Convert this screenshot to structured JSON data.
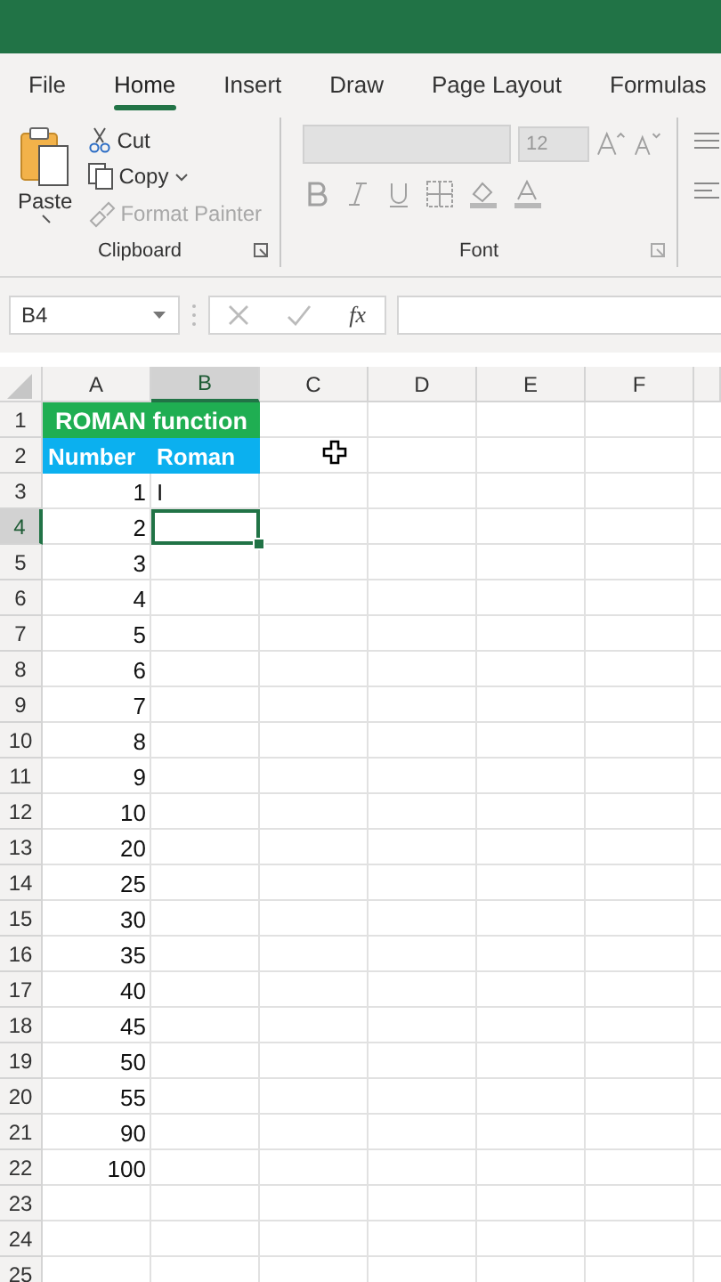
{
  "ribbon": {
    "tabs": [
      {
        "label": "File",
        "selected": false
      },
      {
        "label": "Home",
        "selected": true
      },
      {
        "label": "Insert",
        "selected": false
      },
      {
        "label": "Draw",
        "selected": false
      },
      {
        "label": "Page Layout",
        "selected": false
      },
      {
        "label": "Formulas",
        "selected": false
      }
    ],
    "clipboard": {
      "label": "Clipboard",
      "paste": "Paste",
      "cut": "Cut",
      "copy": "Copy",
      "format_painter": {
        "label": "Format Painter",
        "disabled": true
      }
    },
    "font": {
      "label": "Font",
      "size": "12",
      "disabled": true
    }
  },
  "formula_bar": {
    "name_box": "B4",
    "function_label": "fx"
  },
  "grid": {
    "columns": [
      {
        "label": "A",
        "selected": false
      },
      {
        "label": "B",
        "selected": true
      },
      {
        "label": "C",
        "selected": false
      },
      {
        "label": "D",
        "selected": false
      },
      {
        "label": "E",
        "selected": false
      },
      {
        "label": "F",
        "selected": false
      }
    ],
    "rows": [
      {
        "number": "1",
        "kind": "title",
        "a": "ROMAN function",
        "selected": false
      },
      {
        "number": "2",
        "kind": "header",
        "a": "Number",
        "b": "Roman",
        "selected": false
      },
      {
        "number": "3",
        "kind": "data",
        "a": "1",
        "b": "I",
        "selected": false
      },
      {
        "number": "4",
        "kind": "data",
        "a": "2",
        "selected": true
      },
      {
        "number": "5",
        "kind": "data",
        "a": "3",
        "selected": false
      },
      {
        "number": "6",
        "kind": "data",
        "a": "4",
        "selected": false
      },
      {
        "number": "7",
        "kind": "data",
        "a": "5",
        "selected": false
      },
      {
        "number": "8",
        "kind": "data",
        "a": "6",
        "selected": false
      },
      {
        "number": "9",
        "kind": "data",
        "a": "7",
        "selected": false
      },
      {
        "number": "10",
        "kind": "data",
        "a": "8",
        "selected": false
      },
      {
        "number": "11",
        "kind": "data",
        "a": "9",
        "selected": false
      },
      {
        "number": "12",
        "kind": "data",
        "a": "10",
        "selected": false
      },
      {
        "number": "13",
        "kind": "data",
        "a": "20",
        "selected": false
      },
      {
        "number": "14",
        "kind": "data",
        "a": "25",
        "selected": false
      },
      {
        "number": "15",
        "kind": "data",
        "a": "30",
        "selected": false
      },
      {
        "number": "16",
        "kind": "data",
        "a": "35",
        "selected": false
      },
      {
        "number": "17",
        "kind": "data",
        "a": "40",
        "selected": false
      },
      {
        "number": "18",
        "kind": "data",
        "a": "45",
        "selected": false
      },
      {
        "number": "19",
        "kind": "data",
        "a": "50",
        "selected": false
      },
      {
        "number": "20",
        "kind": "data",
        "a": "55",
        "selected": false
      },
      {
        "number": "21",
        "kind": "data",
        "a": "90",
        "selected": false
      },
      {
        "number": "22",
        "kind": "data",
        "a": "100",
        "selected": false
      },
      {
        "number": "23",
        "kind": "data",
        "selected": false
      },
      {
        "number": "24",
        "kind": "data",
        "selected": false
      },
      {
        "number": "25",
        "kind": "data",
        "selected": false
      }
    ]
  }
}
